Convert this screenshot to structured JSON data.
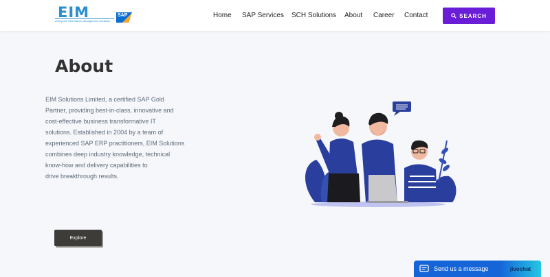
{
  "logo": {
    "text": "EIM",
    "tagline": "enterprise information management solutions",
    "badge": "SAP"
  },
  "nav": {
    "items": [
      "Home",
      "SAP Services",
      "SCH Solutions",
      "About",
      "Career",
      "Contact"
    ],
    "search_label": "SEARCH"
  },
  "main": {
    "title": "About",
    "description": "EIM Solutions Limited, a certified SAP Gold\nPartner, providing best-in-class, innovative and\ncost-effective business transformative IT\nsolutions. Established in 2004 by a team of\nexperienced SAP ERP practitioners, EIM Solutions\ncombines deep industry knowledge, technical\nknow-how and delivery capabilities to\ndrive breakthrough results.",
    "explore_label": "Explore"
  },
  "chat": {
    "label": "Send us a message",
    "brand": "jivochat"
  },
  "colors": {
    "accent": "#6a1dd6",
    "illustration_blue": "#2a3f9d",
    "chat_blue": "#1565d8"
  }
}
